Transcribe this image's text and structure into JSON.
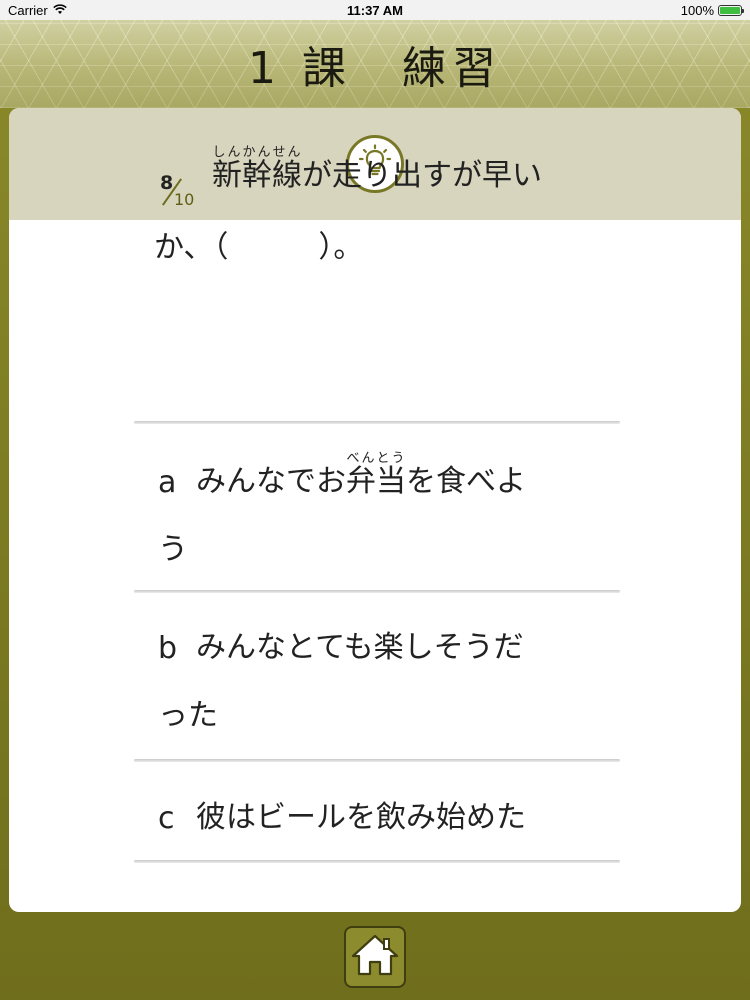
{
  "status_bar": {
    "carrier": "Carrier",
    "time": "11:37 AM",
    "battery": "100%",
    "battery_level": 1.0
  },
  "header": {
    "title": "1 課　練習"
  },
  "hint": {
    "icon": "lightbulb-icon"
  },
  "question": {
    "progress_current": "8",
    "progress_total": "10",
    "ruby_base": "新幹線",
    "ruby_reading": "しんかんせん",
    "text_after_ruby": "が走り出すが早い",
    "line2": "か、（　　　）。"
  },
  "options": [
    {
      "letter": "a",
      "text_before": "みんなでお",
      "ruby_base": "弁当",
      "ruby_reading": "べんとう",
      "text_after": "を食べよ",
      "line2": "う"
    },
    {
      "letter": "b",
      "text": "みんなとても楽しそうだ",
      "line2": "った"
    },
    {
      "letter": "c",
      "text": "彼はビールを飲み始めた"
    }
  ],
  "footer": {
    "home_icon": "home-icon"
  },
  "colors": {
    "accent": "#787726",
    "background": "#7a7a1e",
    "hint_bar": "#d7d5bd"
  }
}
